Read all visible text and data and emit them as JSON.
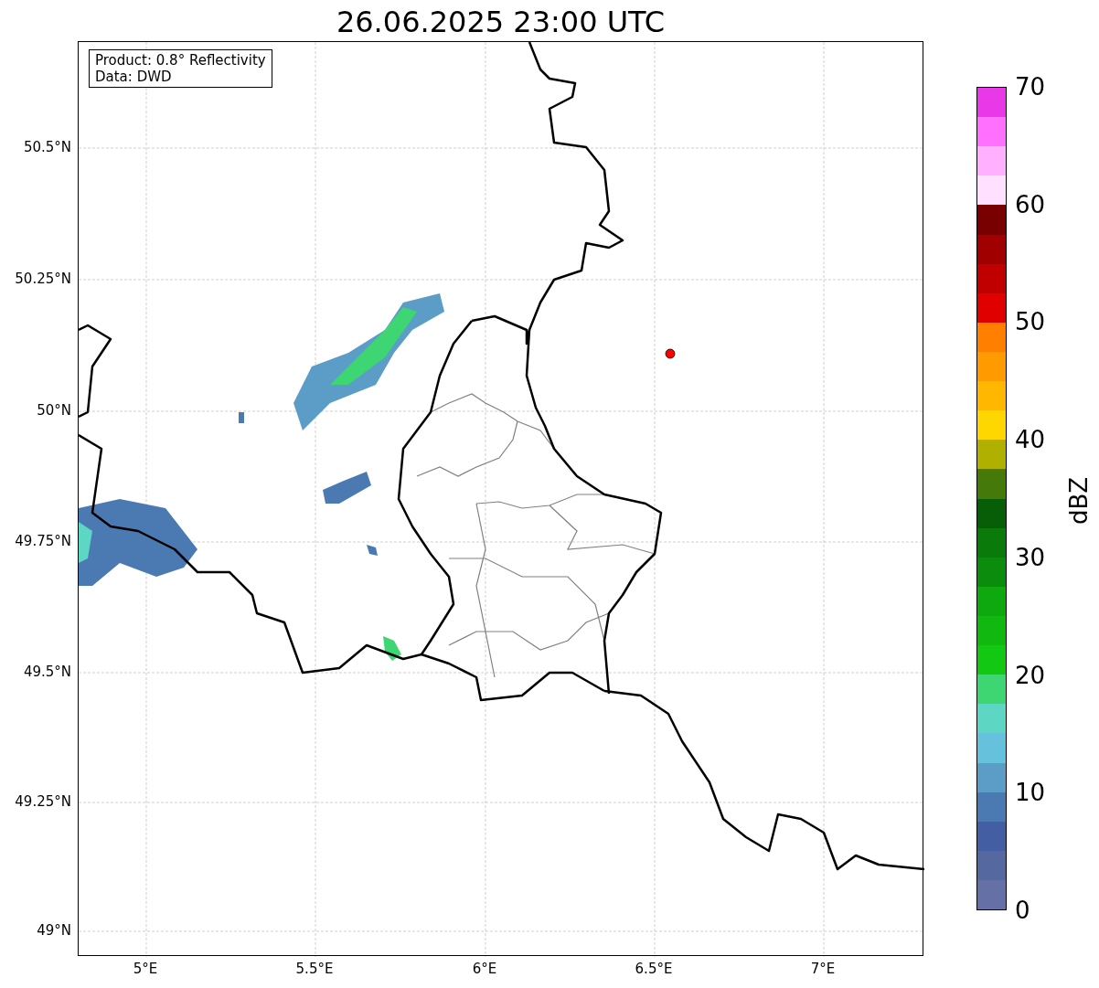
{
  "title": "26.06.2025 23:00 UTC",
  "info_box": [
    "Product: 0.8° Reflectivity",
    "Data: DWD"
  ],
  "map": {
    "lat_ticks": [
      "50.5°N",
      "50.25°N",
      "50°N",
      "49.75°N",
      "49.5°N",
      "49.25°N",
      "49°N"
    ],
    "lon_ticks": [
      "5°E",
      "5.5°E",
      "6°E",
      "6.5°E",
      "7°E"
    ],
    "marker": {
      "color": "#ff0000"
    }
  },
  "colorbar": {
    "label": "dBZ",
    "ticks": [
      "70",
      "60",
      "50",
      "40",
      "30",
      "20",
      "10",
      "0"
    ],
    "bands": [
      {
        "color": "#e838e8"
      },
      {
        "color": "#ff70ff"
      },
      {
        "color": "#ffb0ff"
      },
      {
        "color": "#ffe0ff"
      },
      {
        "color": "#780000"
      },
      {
        "color": "#a00000"
      },
      {
        "color": "#c00000"
      },
      {
        "color": "#e00000"
      },
      {
        "color": "#ff7f00"
      },
      {
        "color": "#ff9b00"
      },
      {
        "color": "#ffb700"
      },
      {
        "color": "#ffd700"
      },
      {
        "color": "#b0b000"
      },
      {
        "color": "#457a0a"
      },
      {
        "color": "#075e07"
      },
      {
        "color": "#0a7a0a"
      },
      {
        "color": "#0c8c0c"
      },
      {
        "color": "#0ea90e"
      },
      {
        "color": "#10b810"
      },
      {
        "color": "#12c812"
      },
      {
        "color": "#3dd672"
      },
      {
        "color": "#5dd6c4"
      },
      {
        "color": "#66c2dc"
      },
      {
        "color": "#5b9dc6"
      },
      {
        "color": "#4a7ab1"
      },
      {
        "color": "#435ea3"
      },
      {
        "color": "#5568a0"
      },
      {
        "color": "#6470a6"
      }
    ]
  }
}
